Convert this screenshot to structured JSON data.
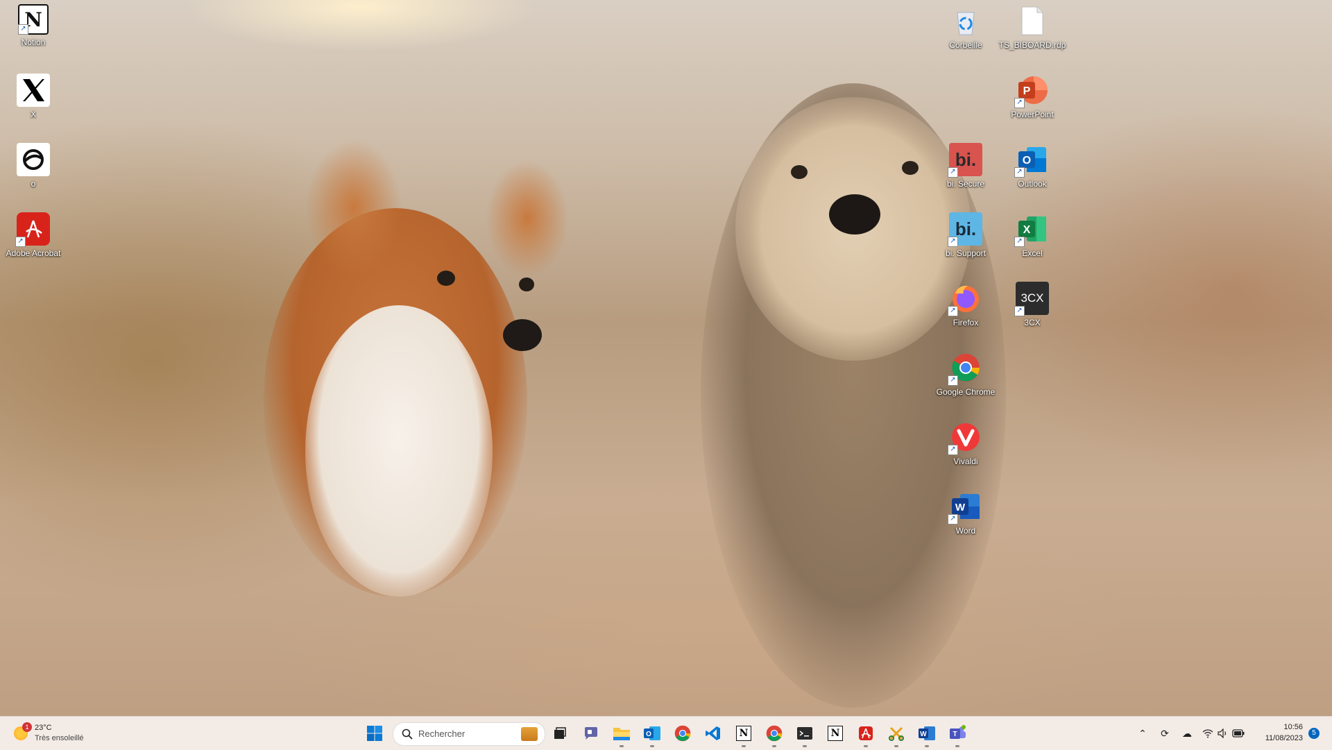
{
  "desktop": {
    "left_icons": [
      {
        "label": "Notion",
        "icon": "notion-icon"
      },
      {
        "label": "X",
        "icon": "x-icon"
      },
      {
        "label": "o",
        "icon": "o-app-icon"
      },
      {
        "label": "Adobe Acrobat",
        "icon": "adobe-acrobat-icon"
      }
    ],
    "right_icons": [
      {
        "label": "Corbeille",
        "icon": "recycle-bin-icon"
      },
      {
        "label": "TS_BIBOARD.rdp",
        "icon": "file-icon"
      },
      {
        "label": "PowerPoint",
        "icon": "powerpoint-icon"
      },
      {
        "label": "bi. Secure",
        "icon": "bi-secure-icon",
        "glyph": "bi."
      },
      {
        "label": "Outlook",
        "icon": "outlook-icon"
      },
      {
        "label": "bi. Support",
        "icon": "bi-support-icon",
        "glyph": "bi."
      },
      {
        "label": "Excel",
        "icon": "excel-icon"
      },
      {
        "label": "Firefox",
        "icon": "firefox-icon"
      },
      {
        "label": "3CX",
        "icon": "3cx-icon",
        "glyph": "3CX"
      },
      {
        "label": "Google Chrome",
        "icon": "chrome-icon"
      },
      {
        "label": "Vivaldi",
        "icon": "vivaldi-icon"
      },
      {
        "label": "Word",
        "icon": "word-icon"
      }
    ]
  },
  "taskbar": {
    "weather": {
      "temp": "23°C",
      "condition": "Très ensoleillé",
      "badge": "1"
    },
    "search_placeholder": "Rechercher",
    "pinned": [
      "windows-start-icon",
      "task-view-icon",
      "teams-chat-icon",
      "file-explorer-icon",
      "outlook-icon",
      "chrome-icon",
      "vscode-icon",
      "notion-icon",
      "chrome-profile-icon",
      "terminal-icon",
      "notion-calendar-icon",
      "acrobat-icon",
      "snipping-tool-icon",
      "word-icon",
      "teams-icon"
    ],
    "clock": {
      "time": "10:56",
      "date": "11/08/2023"
    },
    "notification_count": "5"
  },
  "colors": {
    "taskbar_bg": "#f3ebe6",
    "accent": "#0067c0"
  }
}
